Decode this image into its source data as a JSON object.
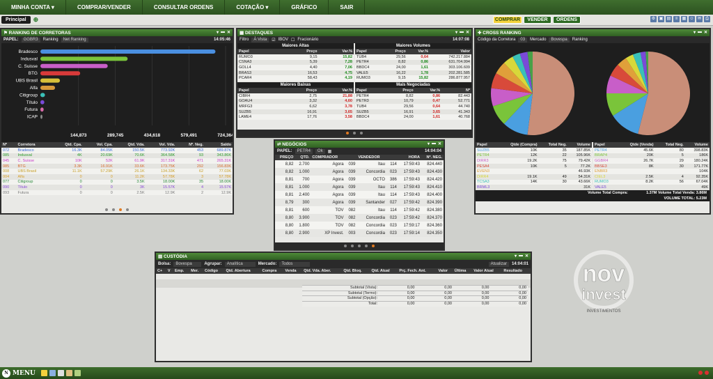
{
  "nav": [
    "MINHA CONTA ▾",
    "COMPRAR/VENDER",
    "CONSULTAR ORDENS",
    "COTAÇÃO ▾",
    "GRÁFICO",
    "SAIR"
  ],
  "tab": "Principal",
  "actions": {
    "comprar": "COMPRAR",
    "vender": "VENDER",
    "ordens": "ORDENS"
  },
  "ranking": {
    "title": "RANKING DE CORRETORAS",
    "papel_label": "PAPEL:",
    "papel": "GGBR3",
    "ranking_label": "Ranking",
    "ranking_val": "Net Ranking",
    "time": "14:05:46",
    "axis": [
      "144,873",
      "289,745",
      "434,618",
      "579,491",
      "724,364"
    ],
    "headers": [
      "Nº",
      "Corretora",
      "Qtd. Cpa.",
      "Vol. Cpa.",
      "Qtd. Vda.",
      "Vol. Vda.",
      "Nº. Neg.",
      "Saldo"
    ],
    "rows": [
      [
        "072",
        "Bradesco",
        "16.3K",
        "84.05K",
        "150.5K",
        "773.92K",
        "453",
        "689.87K"
      ],
      [
        "085",
        "Indusval",
        "4K",
        "20.69K",
        "70.6K",
        "364.58K",
        "93",
        "343.86K"
      ],
      [
        "045",
        "C. Suisse",
        "10K",
        "52K",
        "61.9K",
        "317.31K",
        "471",
        "265.31K"
      ],
      [
        "085",
        "BTG",
        "3.3K",
        "16.91K",
        "33.6K",
        "173.75K",
        "292",
        "156.83K"
      ],
      [
        "008",
        "UBS Brasil",
        "11.1K",
        "57.29K",
        "26.1K",
        "134.33K",
        "62",
        "77.03K"
      ],
      [
        "004",
        "Alfa",
        "0",
        "0",
        "11.2K",
        "57.78K",
        "3",
        "57.78K"
      ],
      [
        "077",
        "Citigroup",
        "0",
        "0",
        "3.5K",
        "18.00K",
        "35",
        "18.00K"
      ],
      [
        "090",
        "Título",
        "0",
        "0",
        "3K",
        "15.57K",
        "4",
        "15.57K"
      ],
      [
        "093",
        "Futura",
        "0",
        "0",
        "2.5K",
        "12.9K",
        "2",
        "12.9K"
      ]
    ]
  },
  "chart_data": {
    "type": "bar",
    "title": "",
    "categories": [
      "Bradesco",
      "Indusval",
      "C. Suisse",
      "BTG",
      "UBS Brasil",
      "Alfa",
      "Citigroup",
      "Título",
      "Futura",
      "ICAP"
    ],
    "values": [
      689870,
      343860,
      265310,
      156830,
      77030,
      57780,
      18000,
      15570,
      12900,
      3000
    ],
    "xlim": [
      0,
      724364
    ],
    "ticks": [
      "144,873",
      "289,745",
      "434,618",
      "579,491",
      "724,364"
    ],
    "colors": [
      "#4a8fe0",
      "#7ac43a",
      "#c85ec8",
      "#d83a3a",
      "#d8c03a",
      "#d89a3a",
      "#3ac0b8",
      "#7a4ad8",
      "#d86aa8",
      "#888888"
    ]
  },
  "destaques": {
    "title": "DESTAQUES",
    "filtro_label": "Filtro",
    "filtro": "À Vista",
    "ibov": "IBOV",
    "fracionario": "Fracionário",
    "time": "14:07:08",
    "altas_title": "Maiores Altas",
    "altas_head": [
      "Papel",
      "Preço",
      "Var.%"
    ],
    "altas": [
      [
        "RUMO3",
        "9,15",
        "15,82"
      ],
      [
        "CSNA3",
        "5,39",
        "7,28"
      ],
      [
        "GOLL4",
        "4,40",
        "7,06"
      ],
      [
        "BRAS3",
        "16,53",
        "4,75"
      ],
      [
        "PCAR4",
        "58,43",
        "4,19"
      ]
    ],
    "volumes_title": "Maiores Volumes",
    "volumes_head": [
      "Papel",
      "Preço",
      "Var.%",
      "Valor"
    ],
    "volumes": [
      [
        "TUB4",
        "29,56",
        "0,64",
        "742.217.884"
      ],
      [
        "PETR4",
        "8,82",
        "0,86",
        "631.704.994"
      ],
      [
        "BBDC4",
        "24,00",
        "1,61",
        "303.106.609"
      ],
      [
        "VALE5",
        "16,22",
        "1,78",
        "202.281.585"
      ],
      [
        "RUMO3",
        "9,15",
        "15,82",
        "286.877.957"
      ]
    ],
    "baixas_title": "Maiores Baixas",
    "baixas_head": [
      "Papel",
      "Preço",
      "Var.%"
    ],
    "baixas": [
      [
        "CIBR4",
        "2,75",
        "21,88"
      ],
      [
        "GOAU4",
        "3,32",
        "4,60"
      ],
      [
        "MRFG3",
        "6,62",
        "3,78"
      ],
      [
        "SUZB5",
        "16,91",
        "3,65"
      ],
      [
        "LAME4",
        "17,76",
        "3,58"
      ]
    ],
    "negociadas_title": "Mais Negociadas",
    "negociadas_head": [
      "Papel",
      "Preço",
      "Var.%",
      "Nº"
    ],
    "negociadas": [
      [
        "PETR4",
        "8,82",
        "0,86",
        "82.443"
      ],
      [
        "PETR3",
        "10,79",
        "0,47",
        "52.771"
      ],
      [
        "TUB4",
        "29,56",
        "0,64",
        "44.740"
      ],
      [
        "SUZB5",
        "16,91",
        "3,65",
        "41.343"
      ],
      [
        "BBDC4",
        "24,00",
        "1,61",
        "40.768"
      ]
    ]
  },
  "cross": {
    "title": "CROSS RANKING",
    "codigo_label": "Código da Corretora",
    "codigo": "03",
    "mercado_label": "Mercado",
    "mercado": "Bovespa",
    "ranking_label": "Ranking",
    "pie_colors": [
      "#c98e78",
      "#4a9fe0",
      "#7ac43a",
      "#c85ec8",
      "#d84a3a",
      "#e0a03a",
      "#d8d83a",
      "#3ac0b8",
      "#7a4ad8",
      "#48a048"
    ],
    "pie1": [
      52,
      10,
      8,
      7,
      6,
      5,
      4,
      3,
      3,
      2
    ],
    "pie2": [
      54,
      12,
      9,
      7,
      5,
      4,
      3,
      3,
      2,
      1
    ],
    "left_head": [
      "Papel",
      "Qtde (Compra)",
      "Total Neg.",
      "Volume"
    ],
    "left": [
      [
        "SUZB5",
        "10K",
        "35",
        "187.85K"
      ],
      [
        "PETR4",
        "12K",
        "22",
        "105.96K"
      ],
      [
        "DIRR3",
        "19.2K",
        "75",
        "79.42K"
      ],
      [
        "PESA4",
        "10K",
        "5",
        "77.2K"
      ],
      [
        "EVEN3",
        "",
        "",
        "46.93K"
      ],
      [
        "DIRR4",
        "19.1K",
        "49",
        "54.31K"
      ],
      [
        "TCSA3",
        "14K",
        "30",
        "43.66K"
      ],
      [
        "BRML3",
        "",
        "",
        "31K"
      ]
    ],
    "right_head": [
      "Papel",
      "Qtde (Venda)",
      "Total Neg.",
      "Volume"
    ],
    "right": [
      [
        "PETR4",
        "45.6K",
        "80",
        "398.83K"
      ],
      [
        "BRAP4",
        "20K",
        "5",
        "186K"
      ],
      [
        "GGBR4",
        "26.7K",
        "29",
        "180.24K"
      ],
      [
        "BBSE3",
        "8K",
        "30",
        "171.77K"
      ],
      [
        "ENBR3",
        "",
        "",
        "104K"
      ],
      [
        "CIEL3",
        "2.5K",
        "4",
        "92.35K"
      ],
      [
        "RUMO3",
        "8.2K",
        "56",
        "67.04K"
      ],
      [
        "VALE5",
        "",
        "",
        "49K"
      ]
    ],
    "total_compra_label": "Volume Total Compra:",
    "total_compra": "1.37M",
    "total_venda_label": "Volume Total Venda:",
    "total_venda": "3.86M",
    "total_label": "VOLUME TOTAL:",
    "total": "5.23M"
  },
  "negocios": {
    "title": "NEGÓCIOS",
    "papel_label": "PAPEL:",
    "papel": "PETR4",
    "ok": "Ok",
    "time": "14:04:04",
    "head": [
      "PREÇO",
      "QTD.",
      "COMPRADOR",
      "",
      "VENDEDOR",
      "",
      "HORA",
      "Nº. NEG."
    ],
    "rows": [
      [
        "8,82",
        "2.700",
        "Agora",
        "039",
        "Itau",
        "114",
        "17:59:43",
        "824.440"
      ],
      [
        "8,82",
        "1.000",
        "Agora",
        "039",
        "Concordia",
        "023",
        "17:59:43",
        "824.430"
      ],
      [
        "8,81",
        "700",
        "Agora",
        "039",
        "OCTO",
        "386",
        "17:59:43",
        "824.420"
      ],
      [
        "8,81",
        "1.000",
        "Agora",
        "039",
        "Itau",
        "114",
        "17:59:43",
        "824.410"
      ],
      [
        "8,81",
        "2.400",
        "Agora",
        "039",
        "Itau",
        "114",
        "17:59:43",
        "824.400"
      ],
      [
        "8,79",
        "300",
        "Agora",
        "039",
        "Santander",
        "027",
        "17:59:42",
        "824.390"
      ],
      [
        "8,81",
        "600",
        "TOV",
        "082",
        "Itau",
        "114",
        "17:59:42",
        "824.380"
      ],
      [
        "8,80",
        "3.900",
        "TOV",
        "082",
        "Concordia",
        "023",
        "17:59:42",
        "824.370"
      ],
      [
        "8,80",
        "1.800",
        "TOV",
        "082",
        "Concordia",
        "023",
        "17:59:17",
        "824.360"
      ],
      [
        "8,80",
        "2.900",
        "XP Invest.",
        "003",
        "Concordia",
        "023",
        "17:59:14",
        "824.350"
      ]
    ]
  },
  "custodia": {
    "title": "CUSTÓDIA",
    "bolsa_label": "Bolsa:",
    "bolsa": "Bovespa",
    "agrupar_label": "Agrupar:",
    "agrupar": "Analítica",
    "mercado_label": "Mercado:",
    "mercado": "Todos",
    "atualizar": "Atualizar",
    "time": "14:04:01",
    "head": [
      "C+",
      "V",
      "Emp.",
      "Mer.",
      "Código",
      "Qtd. Abertura",
      "Compra",
      "Venda",
      "Qtd. Vda. Aber.",
      "Qtd. Bloq.",
      "Qtd. Atual",
      "Prç. Fech. Ant.",
      "Valor",
      "Última",
      "Valor Atual",
      "Resultado"
    ],
    "subtotals": [
      [
        "Subtotal (Vista):",
        "0,00",
        "0,00",
        "0,00",
        "0,00"
      ],
      [
        "Subtotal (Termo):",
        "0,00",
        "0,00",
        "0,00",
        "0,00"
      ],
      [
        "Subtotal (Opção):",
        "0,00",
        "0,00",
        "0,00",
        "0,00"
      ],
      [
        "Total:",
        "0,00",
        "0,00",
        "0,00",
        "0,00"
      ]
    ]
  },
  "logo": {
    "line1": "nov",
    "line2": "invest",
    "line3": "INVESTIMENTOS"
  },
  "menu_label": "MENU"
}
